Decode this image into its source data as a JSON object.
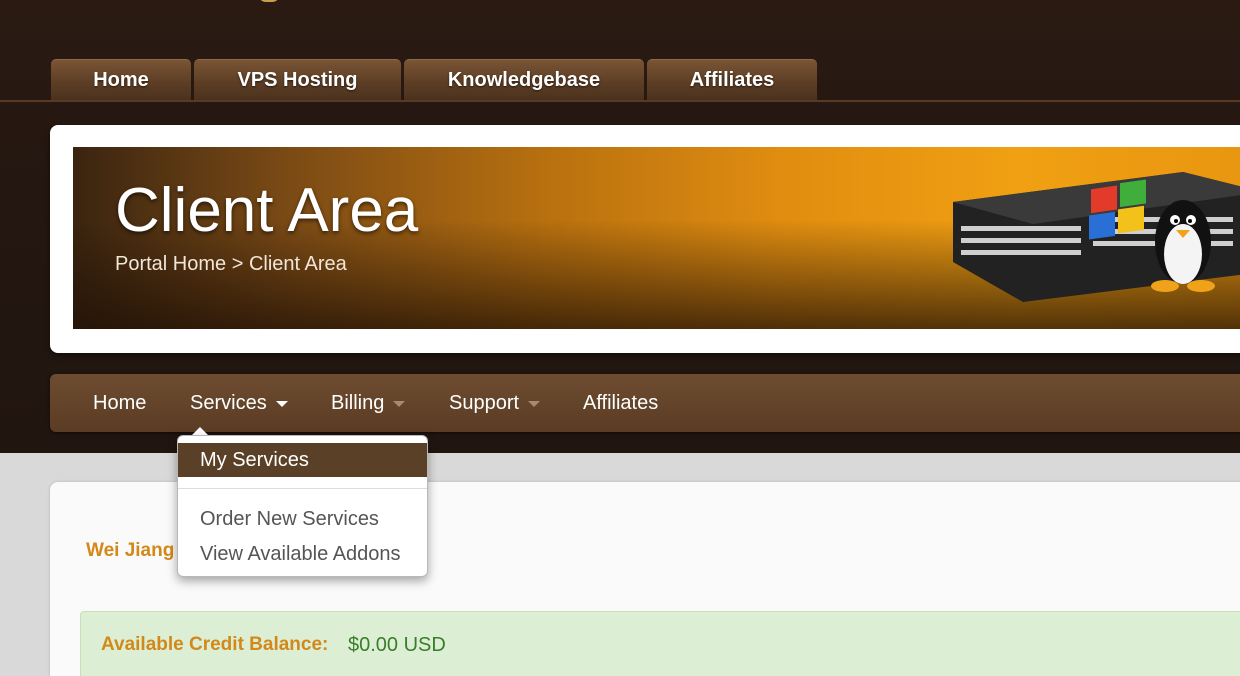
{
  "top_tabs": [
    {
      "label": "Home"
    },
    {
      "label": "VPS Hosting"
    },
    {
      "label": "Knowledgebase"
    },
    {
      "label": "Affiliates"
    }
  ],
  "banner": {
    "title": "Client Area",
    "breadcrumb": {
      "home": "Portal Home",
      "separator": ">",
      "current": "Client Area"
    }
  },
  "main_nav": {
    "items": [
      {
        "label": "Home"
      },
      {
        "label": "Services",
        "has_dropdown": true,
        "open": true
      },
      {
        "label": "Billing",
        "has_dropdown": true
      },
      {
        "label": "Support",
        "has_dropdown": true
      },
      {
        "label": "Affiliates"
      }
    ]
  },
  "services_dropdown": {
    "items": [
      {
        "label": "My Services",
        "active": true
      },
      {
        "label": "Order New Services"
      },
      {
        "label": "View Available Addons"
      }
    ]
  },
  "user": {
    "name": "Wei Jiang"
  },
  "credit": {
    "label": "Available Credit Balance:",
    "value": "$0.00 USD"
  },
  "colors": {
    "header_bg": "#241711",
    "tab_brown": "#5d3e25",
    "banner_orange": "#e08d10",
    "accent_orange": "#d2891a",
    "success_bg": "#dcefd4",
    "success_text": "#3a7d2a"
  }
}
